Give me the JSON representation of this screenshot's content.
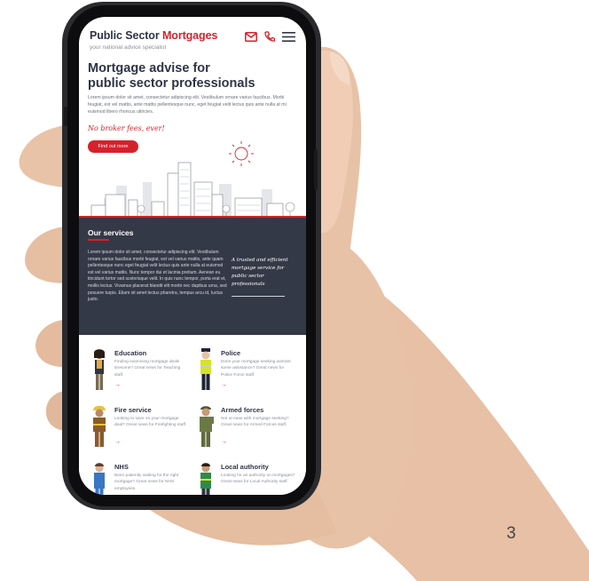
{
  "slide": {
    "number": "3"
  },
  "site": {
    "brand_part1": "Public Sector",
    "brand_part2": "Mortgages",
    "tagline": "your national advice specialist",
    "accent_color": "#d6212b",
    "dark_color": "#343947"
  },
  "header": {
    "icons": [
      "mail-icon",
      "phone-icon",
      "menu-icon"
    ]
  },
  "hero": {
    "title_line1": "Mortgage advise for",
    "title_line2": "public sector professionals",
    "body": "Lorem ipsum dolor sit amet, consectetur adipiscing elit. Vestibulum ornare varius faucibus. Morbi feugiat, est vel mattis, ante mattis pellentesque nunc, eget feugiat velit lectus quis ante nulla at mi euismod libero rhoncus ultricies.",
    "highlight": "No broker fees, ever!",
    "cta": "Find out more"
  },
  "services": {
    "title": "Our services",
    "body": "Lorem ipsum dolor sit amet, consectetur adipiscing elit. Vestibulum ornare varius faucibus morbi feugiat, est vel varius mattis, ante quam pellentesque nunc eget feugiat velit lectus quis ante nulla at euismod est vel varius mattis. Nunc tempor dui et lacinia pretium. Aenean eu tincidunt tortor sed scelerisque velit. In quis nunc tempor, porta erat et, mollis lectus. Vivamus placerat blandit elit morbi nec dapibus urna, sed posuere turpis. Etiam sit amet lectus pharetra, tempus arcu id, luctus justo.",
    "quote": "A trusted and efficient mortgage service for public sector professionals"
  },
  "cards": [
    {
      "title": "Education",
      "desc": "Finding examining mortgage deals tiresome? Great news for Teaching staff.",
      "arrow": "→"
    },
    {
      "title": "Police",
      "desc": "Does your mortgage seeking warrant some assistance? Great news for Police Force staff.",
      "arrow": "→"
    },
    {
      "title": "Fire service",
      "desc": "Looking to save on your mortgage deal? Great news for Firefighting staff.",
      "arrow": "→"
    },
    {
      "title": "Armed forces",
      "desc": "Not at ease with mortgage seeking? Great news for Armed Forces staff.",
      "arrow": "→"
    },
    {
      "title": "NHS",
      "desc": "Been patiently waiting for the right mortgage? Great news for NHS employees.",
      "arrow": ""
    },
    {
      "title": "Local authority",
      "desc": "Looking for an authority on mortgages? Great news for Local Authority staff.",
      "arrow": ""
    }
  ]
}
